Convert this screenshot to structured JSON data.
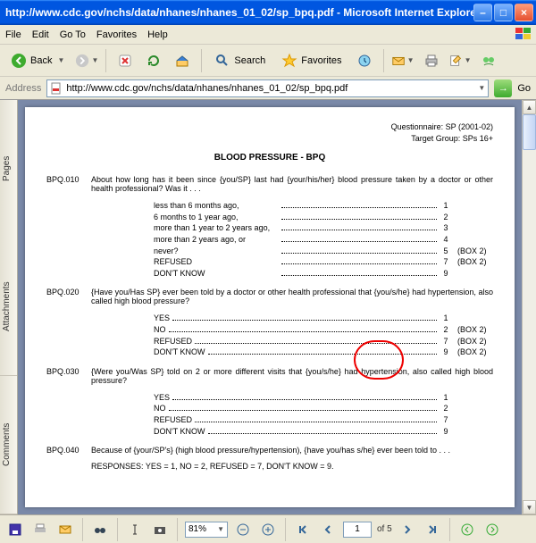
{
  "window": {
    "title": "http://www.cdc.gov/nchs/data/nhanes/nhanes_01_02/sp_bpq.pdf - Microsoft Internet Explorer"
  },
  "menu": {
    "file": "File",
    "edit": "Edit",
    "goto": "Go To",
    "fav": "Favorites",
    "help": "Help"
  },
  "tb": {
    "back": "Back",
    "search": "Search",
    "favorites": "Favorites"
  },
  "addr": {
    "label": "Address",
    "url": "http://www.cdc.gov/nchs/data/nhanes/nhanes_01_02/sp_bpq.pdf",
    "go": "Go"
  },
  "sidetabs": {
    "pages": "Pages",
    "attachments": "Attachments",
    "comments": "Comments"
  },
  "doc": {
    "header1": "Questionnaire:   SP (2001-02)",
    "header2": "Target Group:   SPs 16+",
    "title": "BLOOD PRESSURE - BPQ",
    "q010": {
      "code": "BPQ.010",
      "text": "About how long has it been since {you/SP} last had {your/his/her} blood pressure taken by a doctor or other health professional?  Was it . . .",
      "opts": [
        {
          "l": "less than 6 months ago,",
          "c": "1",
          "x": ""
        },
        {
          "l": "6 months to 1 year ago,",
          "c": "2",
          "x": ""
        },
        {
          "l": "more than 1 year to 2 years ago,",
          "c": "3",
          "x": ""
        },
        {
          "l": "more than 2 years ago, or",
          "c": "4",
          "x": ""
        },
        {
          "l": "never?",
          "c": "5",
          "x": "(BOX 2)"
        },
        {
          "l": "REFUSED",
          "c": "7",
          "x": "(BOX 2)"
        },
        {
          "l": "DON'T KNOW",
          "c": "9",
          "x": ""
        }
      ]
    },
    "q020": {
      "code": "BPQ.020",
      "text": "{Have you/Has SP} ever been told by a doctor or other health professional that {you/s/he} had hypertension, also called high blood pressure?",
      "opts": [
        {
          "l": "YES",
          "c": "1",
          "x": ""
        },
        {
          "l": "NO",
          "c": "2",
          "x": "(BOX 2)"
        },
        {
          "l": "REFUSED",
          "c": "7",
          "x": "(BOX 2)"
        },
        {
          "l": "DON'T KNOW",
          "c": "9",
          "x": "(BOX 2)"
        }
      ]
    },
    "q030": {
      "code": "BPQ.030",
      "text": "{Were you/Was SP} told on 2 or more different visits that {you/s/he} had hypertension, also called high blood pressure?",
      "opts": [
        {
          "l": "YES",
          "c": "1",
          "x": ""
        },
        {
          "l": "NO",
          "c": "2",
          "x": ""
        },
        {
          "l": "REFUSED",
          "c": "7",
          "x": ""
        },
        {
          "l": "DON'T KNOW",
          "c": "9",
          "x": ""
        }
      ]
    },
    "q040": {
      "code": "BPQ.040",
      "text": "Because of {your/SP's} (high blood pressure/hypertension), {have you/has s/he} ever been told to . . .",
      "resp": "RESPONSES:  YES = 1, NO = 2, REFUSED = 7, DON'T KNOW = 9."
    }
  },
  "reader": {
    "zoom": "81%",
    "page": "1",
    "pages": "of 5"
  }
}
